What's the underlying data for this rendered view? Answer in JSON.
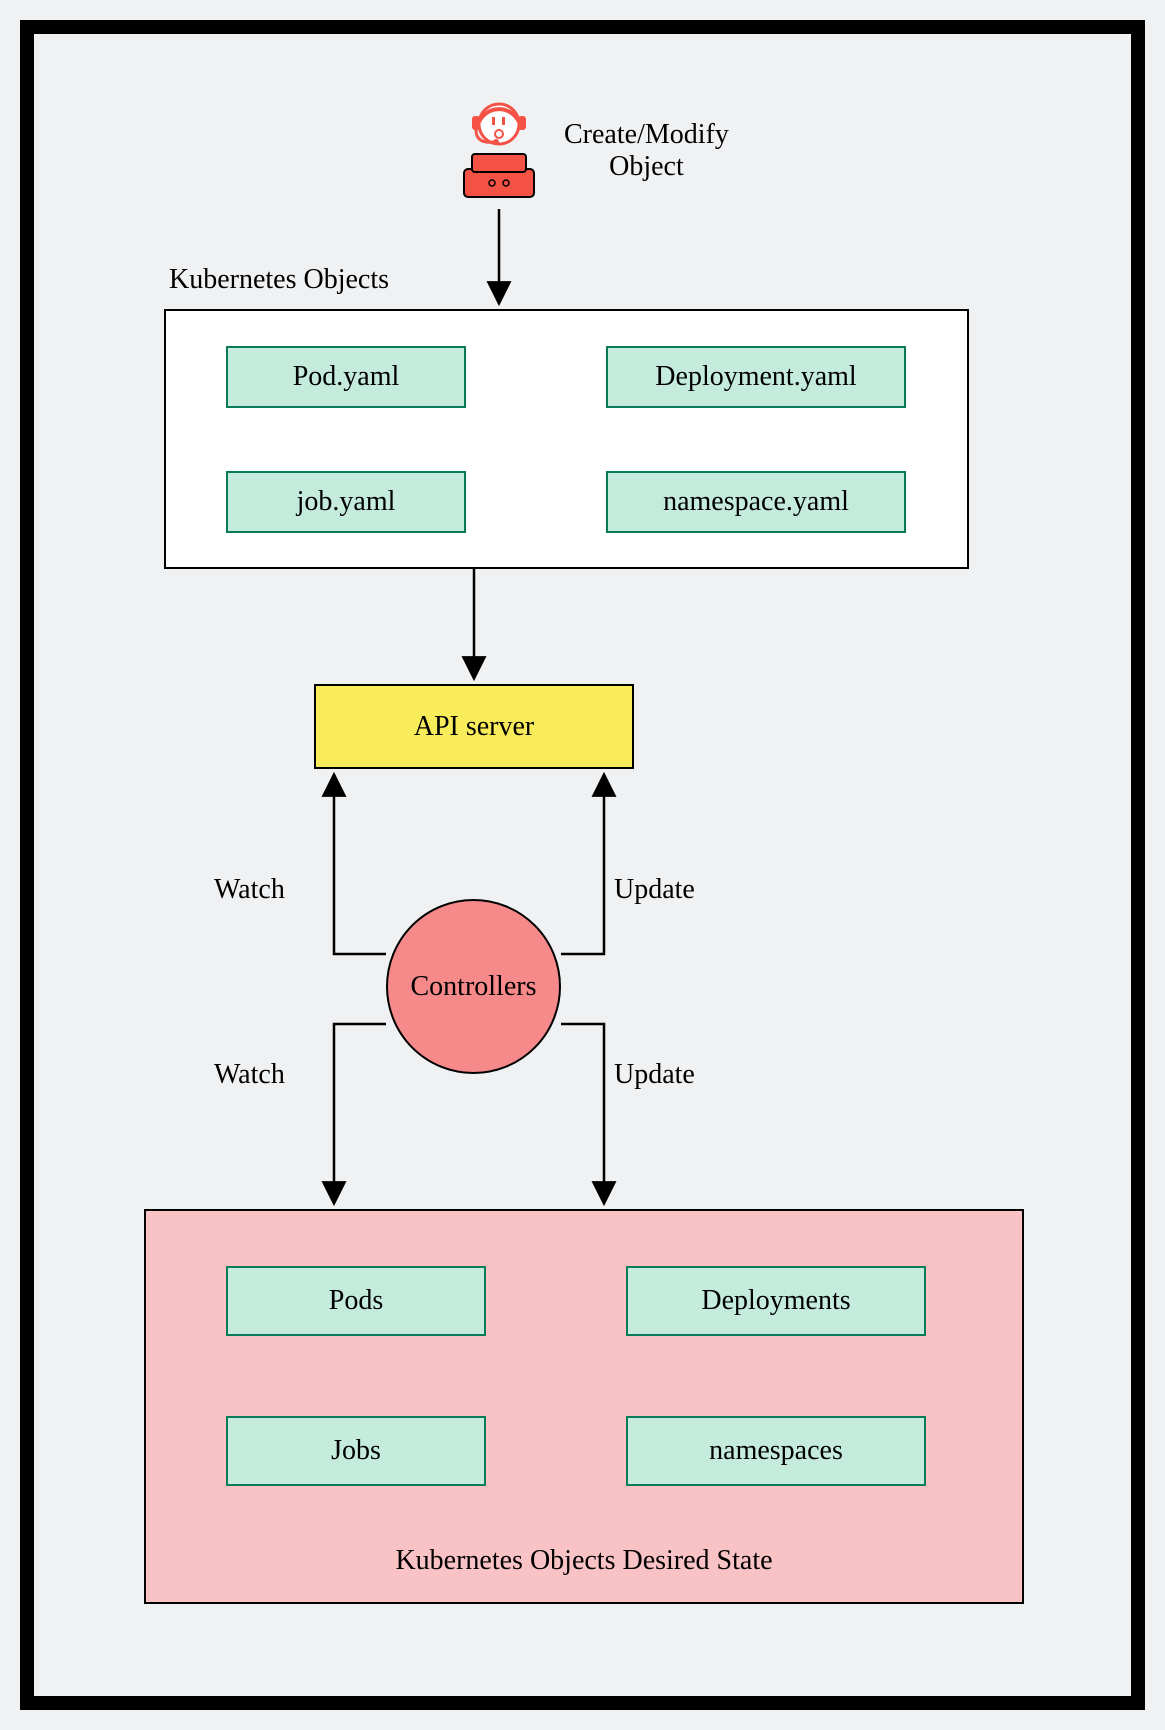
{
  "user_action": "Create/Modify\nObject",
  "objects_title": "Kubernetes Objects",
  "object_tiles": {
    "pod": "Pod.yaml",
    "deployment": "Deployment.yaml",
    "job": "job.yaml",
    "namespace": "namespace.yaml"
  },
  "api_server": "API server",
  "controllers": "Controllers",
  "edges": {
    "watch_up": "Watch",
    "update_up": "Update",
    "watch_down": "Watch",
    "update_down": "Update"
  },
  "desired_state_title": "Kubernetes Objects Desired State",
  "desired_tiles": {
    "pods": "Pods",
    "deployments": "Deployments",
    "jobs": "Jobs",
    "namespaces": "namespaces"
  }
}
